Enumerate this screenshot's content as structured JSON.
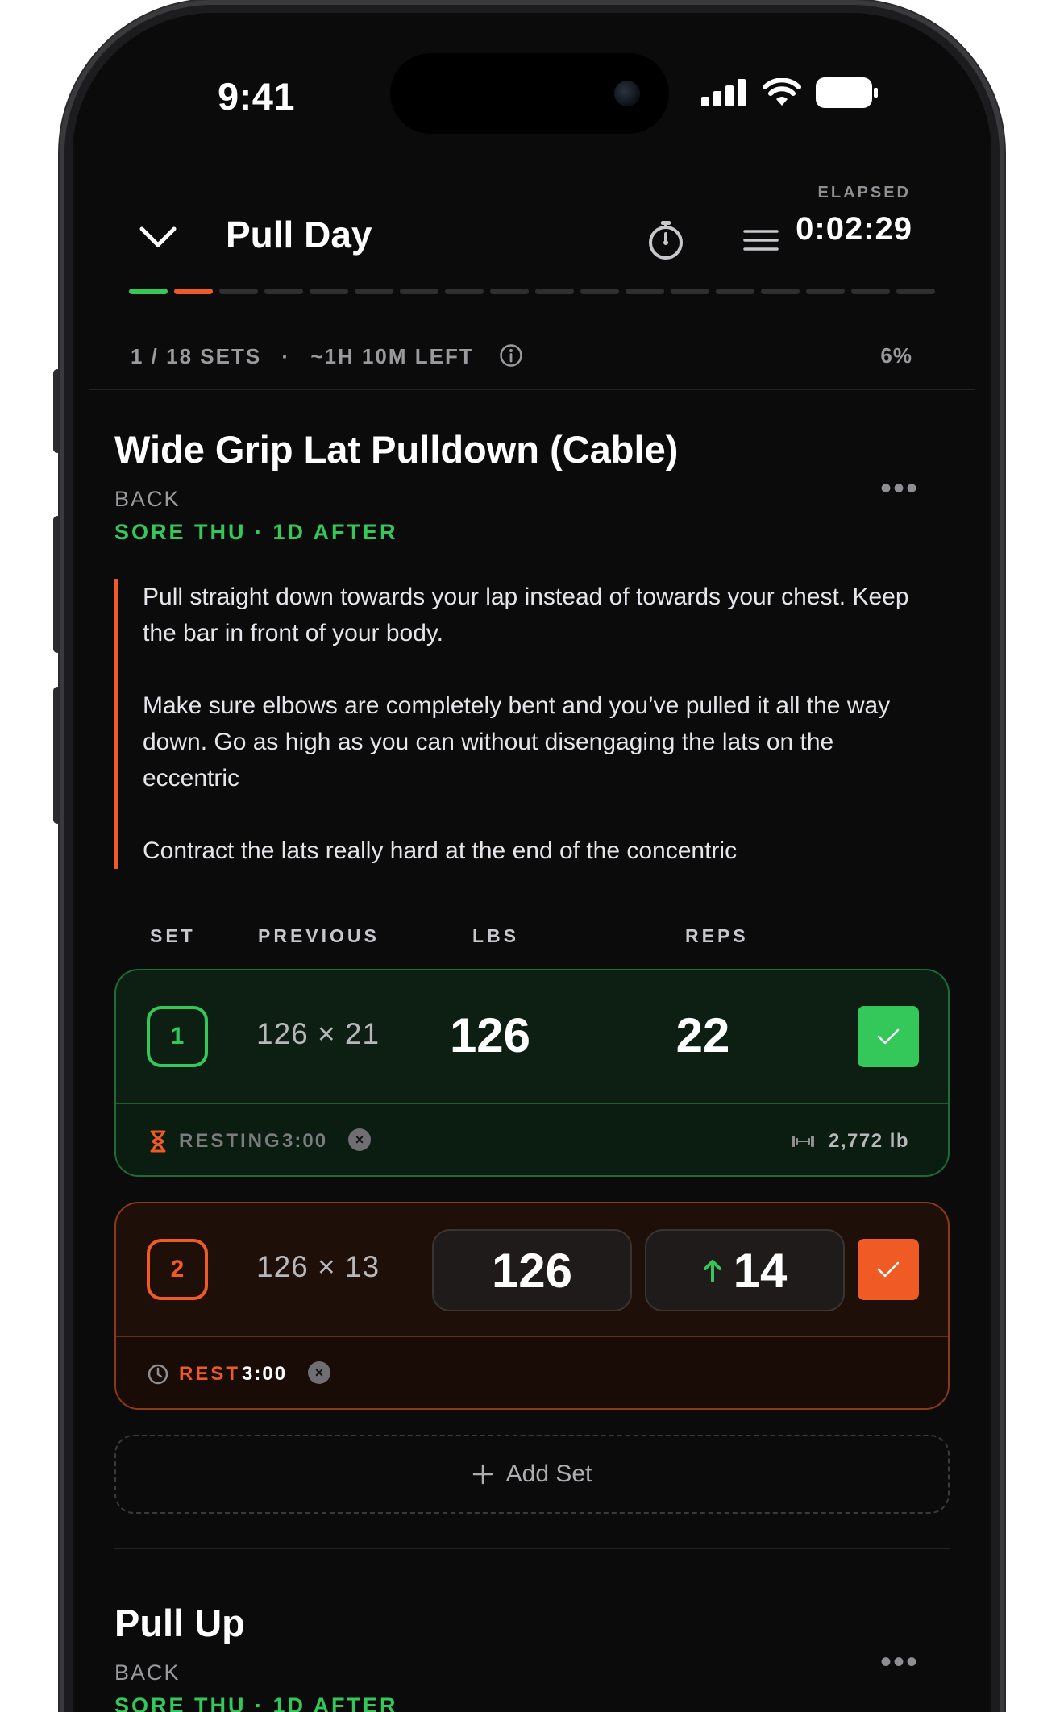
{
  "status_bar": {
    "time": "9:41"
  },
  "header": {
    "title": "Pull Day",
    "elapsed_label": "ELAPSED",
    "elapsed_time": "0:02:29"
  },
  "progress": {
    "completed_segments": 1,
    "current_segment": 2,
    "total_segments": 18,
    "sets_text": "1 / 18 SETS",
    "separator": "·",
    "time_left_text": "~1H 10M LEFT",
    "percent_text": "6%",
    "colors": {
      "done": "#34c759",
      "current": "#f05a24",
      "pending": "#2f2f31"
    }
  },
  "exercises": [
    {
      "title": "Wide Grip Lat Pulldown (Cable)",
      "category": "BACK",
      "soreness": "SORE THU · 1D AFTER",
      "notes": [
        "Pull straight down towards your lap instead of towards your chest. Keep the bar in front of your body.",
        "Make sure elbows are completely bent and you’ve pulled it all the way down. Go as high as you can without disengaging the lats on the eccentric",
        "Contract the lats really hard at the end of the concentric"
      ]
    },
    {
      "title": "Pull Up",
      "category": "BACK",
      "soreness": "SORE THU · 1D AFTER"
    }
  ],
  "table_headers": {
    "set": "SET",
    "previous": "PREVIOUS",
    "lbs": "LBS",
    "reps": "REPS"
  },
  "sets": [
    {
      "number": "1",
      "previous": "126 × 21",
      "lbs": "126",
      "reps": "22",
      "state": "completed",
      "rest_label": "RESTING",
      "rest_time": "3:00",
      "volume": "2,772 lb"
    },
    {
      "number": "2",
      "previous": "126 × 13",
      "lbs": "126",
      "reps": "14",
      "state": "active",
      "rest_label": "REST",
      "rest_time": "3:00"
    }
  ],
  "add_set_label": "Add Set",
  "accent": {
    "green": "#34c759",
    "orange": "#f05a24"
  }
}
